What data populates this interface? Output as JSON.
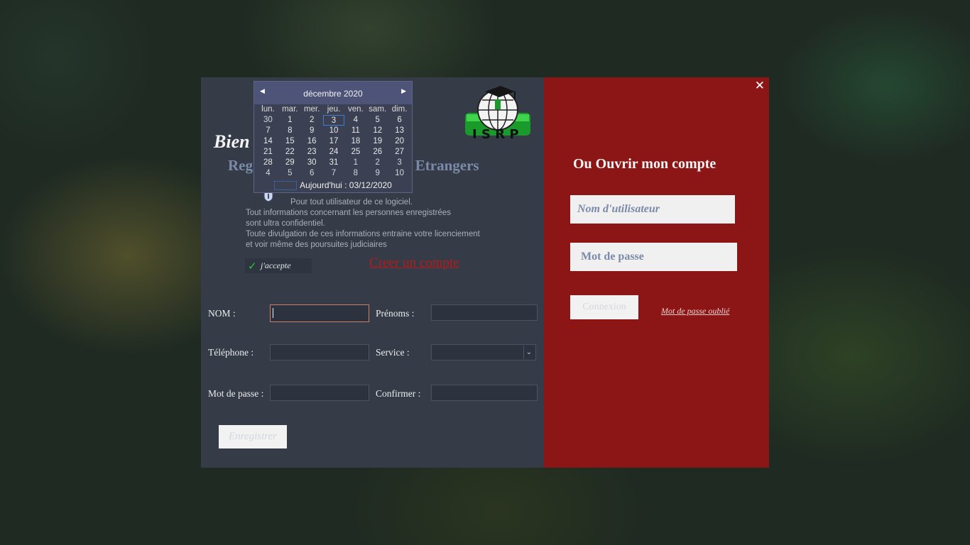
{
  "left": {
    "welcome_visible": "Bien",
    "subtitle_left": "Reg",
    "subtitle_right": "es Etrangers",
    "notice": {
      "line1": "Pour tout utilisateur de ce logiciel.",
      "line2": "Tout informations concernant les personnes enregistrées",
      "line3": "sont ultra confidentiel.",
      "line4": "Toute divulgation de ces informations entraine votre licenciement",
      "line5": "et voir même des poursuites judiciaires"
    },
    "accept_label": "j'accepte",
    "create_account": "Creer un compte",
    "form": {
      "nom_label": "NOM :",
      "prenoms_label": "Prénoms :",
      "telephone_label": "Téléphone :",
      "service_label": "Service :",
      "password_label": "Mot de passe :",
      "confirm_label": "Confirmer :"
    },
    "save_button": "Enregistrer"
  },
  "right": {
    "title": "Ou Ouvrir mon compte",
    "username_placeholder": "Nom d'utilisateur",
    "password_placeholder": "Mot de passe",
    "connect_button": "Connexion",
    "forgot_link": "Mot de passe oublié"
  },
  "calendar": {
    "month": "décembre 2020",
    "weekdays": [
      "lun.",
      "mar.",
      "mer.",
      "jeu.",
      "ven.",
      "sam.",
      "dim."
    ],
    "weeks": [
      [
        "30",
        "1",
        "2",
        "3",
        "4",
        "5",
        "6"
      ],
      [
        "7",
        "8",
        "9",
        "10",
        "11",
        "12",
        "13"
      ],
      [
        "14",
        "15",
        "16",
        "17",
        "18",
        "19",
        "20"
      ],
      [
        "21",
        "22",
        "23",
        "24",
        "25",
        "26",
        "27"
      ],
      [
        "28",
        "29",
        "30",
        "31",
        "1",
        "2",
        "3"
      ],
      [
        "4",
        "5",
        "6",
        "7",
        "8",
        "9",
        "10"
      ]
    ],
    "today_label": "Aujourd'hui : 03/12/2020"
  },
  "icons": {
    "close": "close-icon",
    "check": "check-icon",
    "logo": "isrp-logo",
    "shield": "shield-icon"
  },
  "colors": {
    "left_bg": "#353c48",
    "right_bg": "#8c1515",
    "link_red": "#b51b1b",
    "accent_blue": "#7b8aa8"
  }
}
